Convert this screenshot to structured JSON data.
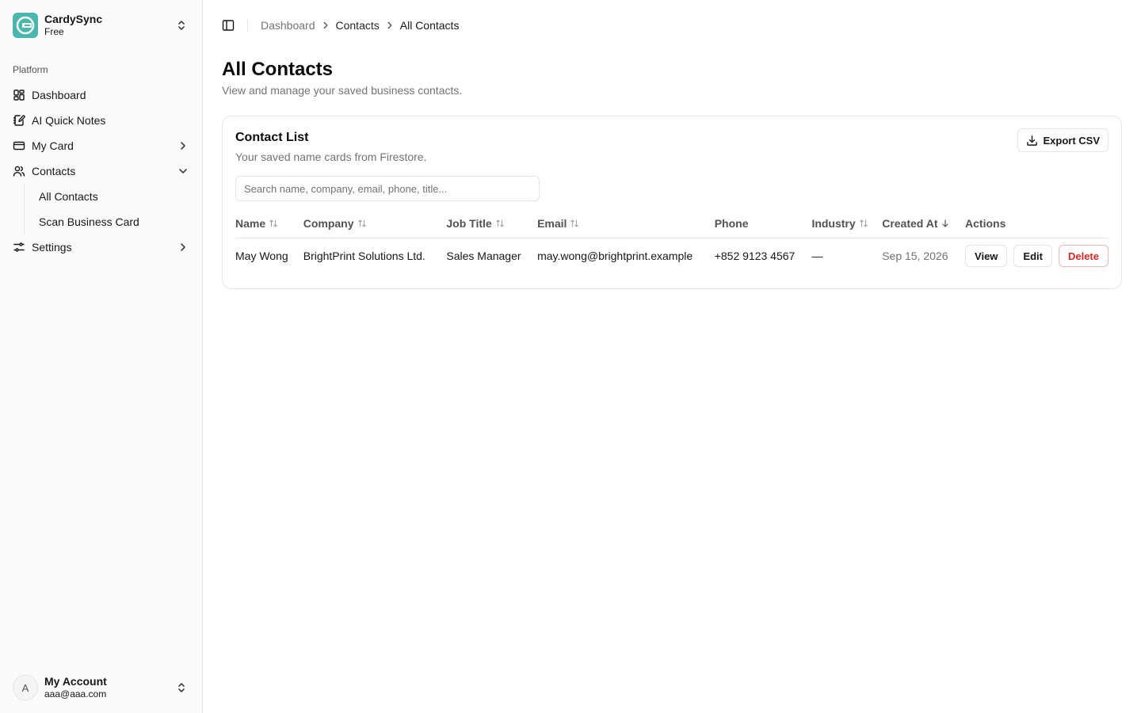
{
  "sidebar": {
    "team": {
      "name": "CardySync",
      "plan": "Free"
    },
    "group_label": "Platform",
    "items": [
      {
        "label": "Dashboard",
        "icon": "layout-dashboard-icon"
      },
      {
        "label": "AI Quick Notes",
        "icon": "notebook-pen-icon"
      },
      {
        "label": "My Card",
        "icon": "credit-card-icon",
        "chevron": "chevron-right-icon"
      },
      {
        "label": "Contacts",
        "icon": "users-icon",
        "chevron": "chevron-down-icon",
        "expanded": true,
        "children": [
          {
            "label": "All Contacts"
          },
          {
            "label": "Scan Business Card"
          }
        ]
      },
      {
        "label": "Settings",
        "icon": "settings-sliders-icon",
        "chevron": "chevron-right-icon"
      }
    ],
    "account": {
      "initial": "A",
      "name": "My Account",
      "email": "aaa@aaa.com"
    }
  },
  "breadcrumb": {
    "items": [
      "Dashboard",
      "Contacts",
      "All Contacts"
    ]
  },
  "page": {
    "title": "All Contacts",
    "description": "View and manage your saved business contacts."
  },
  "card": {
    "title": "Contact List",
    "description": "Your saved name cards from Firestore.",
    "export_label": "Export CSV",
    "search_placeholder": "Search name, company, email, phone, title..."
  },
  "table": {
    "columns": [
      {
        "label": "Name",
        "sort": "both"
      },
      {
        "label": "Company",
        "sort": "both"
      },
      {
        "label": "Job Title",
        "sort": "both"
      },
      {
        "label": "Email",
        "sort": "both"
      },
      {
        "label": "Phone",
        "sort": "none"
      },
      {
        "label": "Industry",
        "sort": "both"
      },
      {
        "label": "Created At",
        "sort": "desc"
      },
      {
        "label": "Actions",
        "sort": "none"
      }
    ],
    "rows": [
      {
        "name": "May Wong",
        "company": "BrightPrint Solutions Ltd.",
        "job_title": "Sales Manager",
        "email": "may.wong@brightprint.example",
        "phone": "+852 9123 4567",
        "industry": "—",
        "created_at": "Sep 15, 2026",
        "actions": {
          "view": "View",
          "edit": "Edit",
          "delete": "Delete"
        }
      }
    ]
  },
  "colors": {
    "brand": "#4db6ac",
    "danger": "#dc2626",
    "muted": "#737373",
    "border": "#e5e5e5",
    "sidebar_bg": "#fafafa"
  }
}
